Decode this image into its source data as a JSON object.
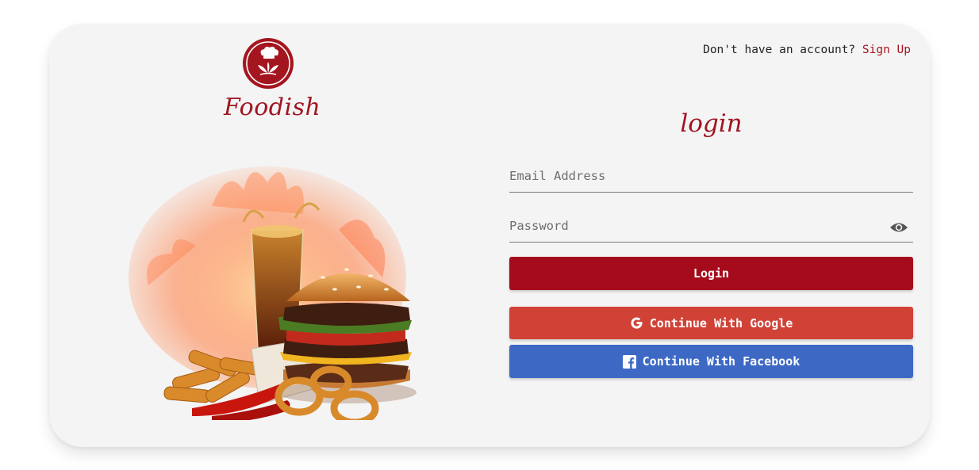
{
  "brand": {
    "name": "Foodish",
    "logo_icon": "chef-hat-leaf-icon",
    "color": "#a4161f"
  },
  "header": {
    "prompt": "Don't have an account?",
    "signup_label": "Sign Up"
  },
  "form": {
    "title": "login",
    "email_placeholder": "Email Address",
    "password_placeholder": "Password",
    "password_toggle_icon": "eye-icon",
    "login_label": "Login"
  },
  "social": {
    "google_label": "Continue With Google",
    "google_icon": "google-icon",
    "google_color": "#d04236",
    "facebook_label": "Continue With Facebook",
    "facebook_icon": "facebook-icon",
    "facebook_color": "#3d69c5"
  },
  "hero": {
    "image": "burger-fries-cola-onion-rings-illustration"
  },
  "colors": {
    "accent": "#a60b1c",
    "card_bg": "#f4f4f4"
  }
}
